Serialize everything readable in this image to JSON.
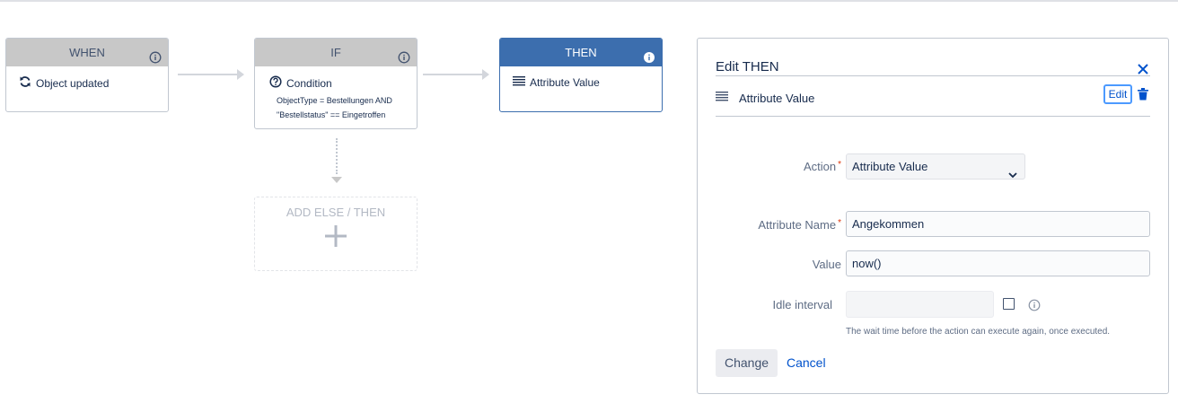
{
  "flow": {
    "when": {
      "header": "WHEN",
      "item": "Object updated",
      "icon": "refresh-icon"
    },
    "if": {
      "header": "IF",
      "item": "Condition",
      "icon": "question-circle-icon",
      "condition_line1": "ObjectType = Bestellungen AND",
      "condition_line2": "\"Bestellstatus\" == Eingetroffen"
    },
    "then": {
      "header": "THEN",
      "item": "Attribute Value",
      "icon": "list-lines-icon"
    },
    "add_else": {
      "label": "ADD ELSE / THEN"
    }
  },
  "panel": {
    "title": "Edit THEN",
    "action_item": "Attribute Value",
    "edit_label": "Edit",
    "fields": {
      "action": {
        "label": "Action",
        "value": "Attribute Value"
      },
      "attribute_name": {
        "label": "Attribute Name",
        "value": "Angekommen"
      },
      "value": {
        "label": "Value",
        "value": "now()"
      },
      "idle_interval": {
        "label": "Idle interval",
        "value": ""
      }
    },
    "hint": "The wait time before the action can execute again, once executed.",
    "change_label": "Change",
    "cancel_label": "Cancel"
  },
  "colors": {
    "then_header": "#3c6eae",
    "link": "#0052cc",
    "required": "#de350b"
  }
}
